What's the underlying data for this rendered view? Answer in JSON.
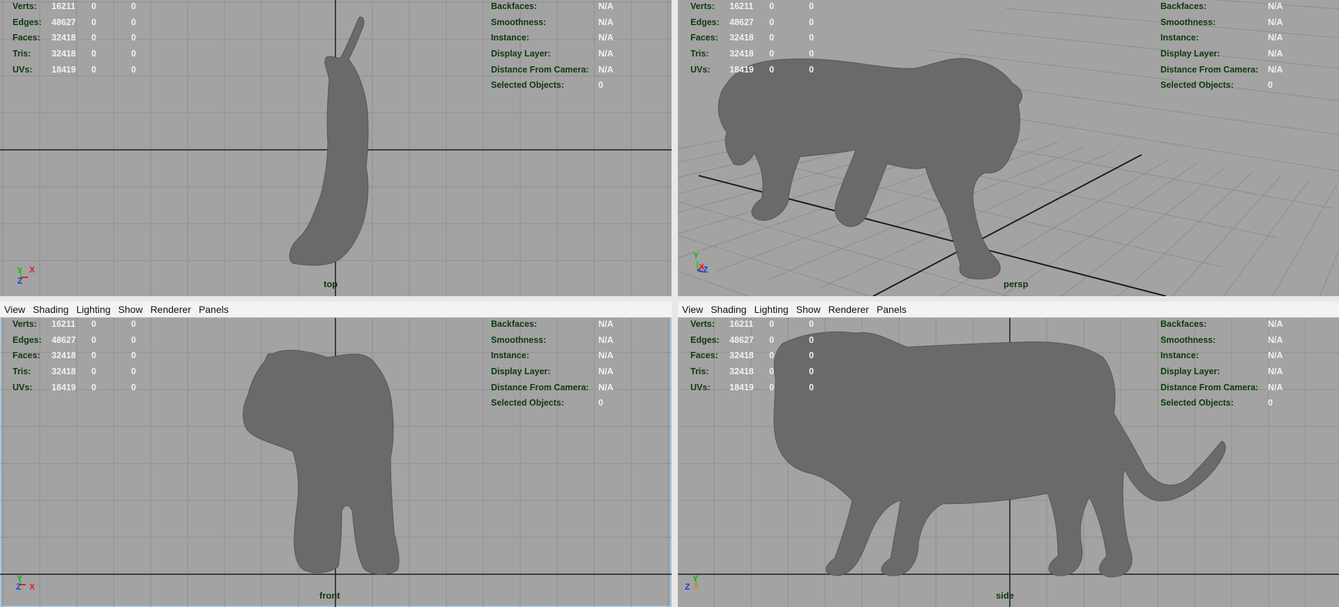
{
  "menu": [
    "View",
    "Shading",
    "Lighting",
    "Show",
    "Renderer",
    "Panels"
  ],
  "hud_stats": {
    "rows": [
      {
        "label": "Verts:",
        "v1": "16211",
        "v2": "0",
        "v3": "0"
      },
      {
        "label": "Edges:",
        "v1": "48627",
        "v2": "0",
        "v3": "0"
      },
      {
        "label": "Faces:",
        "v1": "32418",
        "v2": "0",
        "v3": "0"
      },
      {
        "label": "Tris:",
        "v1": "32418",
        "v2": "0",
        "v3": "0"
      },
      {
        "label": "UVs:",
        "v1": "18419",
        "v2": "0",
        "v3": "0"
      }
    ]
  },
  "hud_info": {
    "rows": [
      {
        "label": "Backfaces:",
        "value": "N/A"
      },
      {
        "label": "Smoothness:",
        "value": "N/A"
      },
      {
        "label": "Instance:",
        "value": "N/A"
      },
      {
        "label": "Display Layer:",
        "value": "N/A"
      },
      {
        "label": "Distance From Camera:",
        "value": "N/A"
      },
      {
        "label": "Selected Objects:",
        "value": "0"
      }
    ]
  },
  "viewports": {
    "top": {
      "camera": "top"
    },
    "persp": {
      "camera": "persp"
    },
    "front": {
      "camera": "front"
    },
    "side": {
      "camera": "side"
    }
  },
  "colors": {
    "viewport_bg": "#a3a3a3",
    "grid_line": "#8a8a8a",
    "axis_line": "#1a1a1a",
    "hud_label": "#0d3b0d",
    "hud_value": "#f2f2f2",
    "active_border": "#a9c7e4",
    "model": "#6b6b6b"
  }
}
